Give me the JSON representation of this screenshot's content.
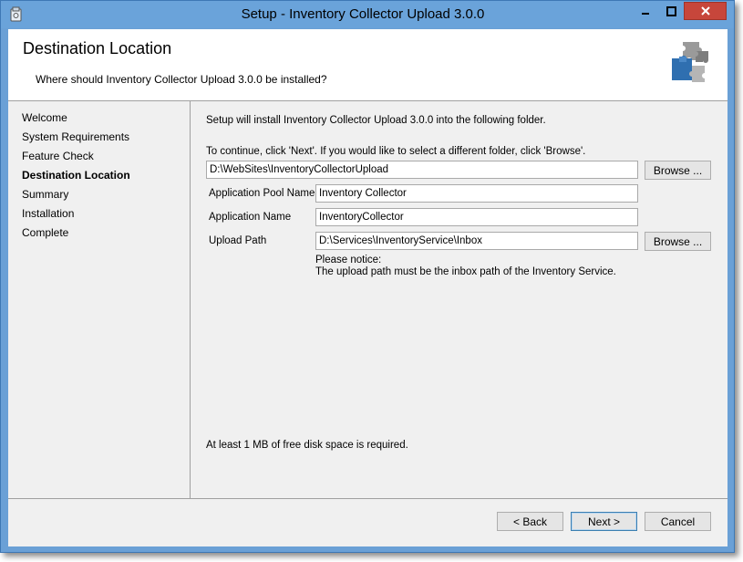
{
  "window": {
    "title": "Setup - Inventory Collector Upload 3.0.0"
  },
  "header": {
    "title": "Destination Location",
    "subtitle": "Where should Inventory Collector Upload 3.0.0 be installed?"
  },
  "sidebar": {
    "steps": [
      {
        "label": "Welcome"
      },
      {
        "label": "System Requirements"
      },
      {
        "label": "Feature Check"
      },
      {
        "label": "Destination Location",
        "active": true
      },
      {
        "label": "Summary"
      },
      {
        "label": "Installation"
      },
      {
        "label": "Complete"
      }
    ]
  },
  "main": {
    "intro": "Setup will install Inventory Collector Upload 3.0.0 into the following folder.",
    "instruction": "To continue, click 'Next'. If you would like to select a different folder, click 'Browse'.",
    "install_path": "D:\\WebSites\\InventoryCollectorUpload",
    "browse_label": "Browse ...",
    "app_pool_label": "Application Pool Name",
    "app_pool_value": "Inventory Collector",
    "app_name_label": "Application Name",
    "app_name_value": "InventoryCollector",
    "upload_path_label": "Upload Path",
    "upload_path_value": "D:\\Services\\InventoryService\\Inbox",
    "notice_title": "Please notice:",
    "notice_text": "The upload path must be the inbox path of the Inventory Service.",
    "disk_space": "At least 1 MB of free disk space is required."
  },
  "footer": {
    "back_label": "< Back",
    "next_label": "Next >",
    "cancel_label": "Cancel"
  },
  "colors": {
    "titlebar": "#6aa3da",
    "close_button": "#c7463b",
    "panel": "#f0f0f0"
  },
  "icons": {
    "app": "installer-icon",
    "header": "puzzle-icon"
  }
}
